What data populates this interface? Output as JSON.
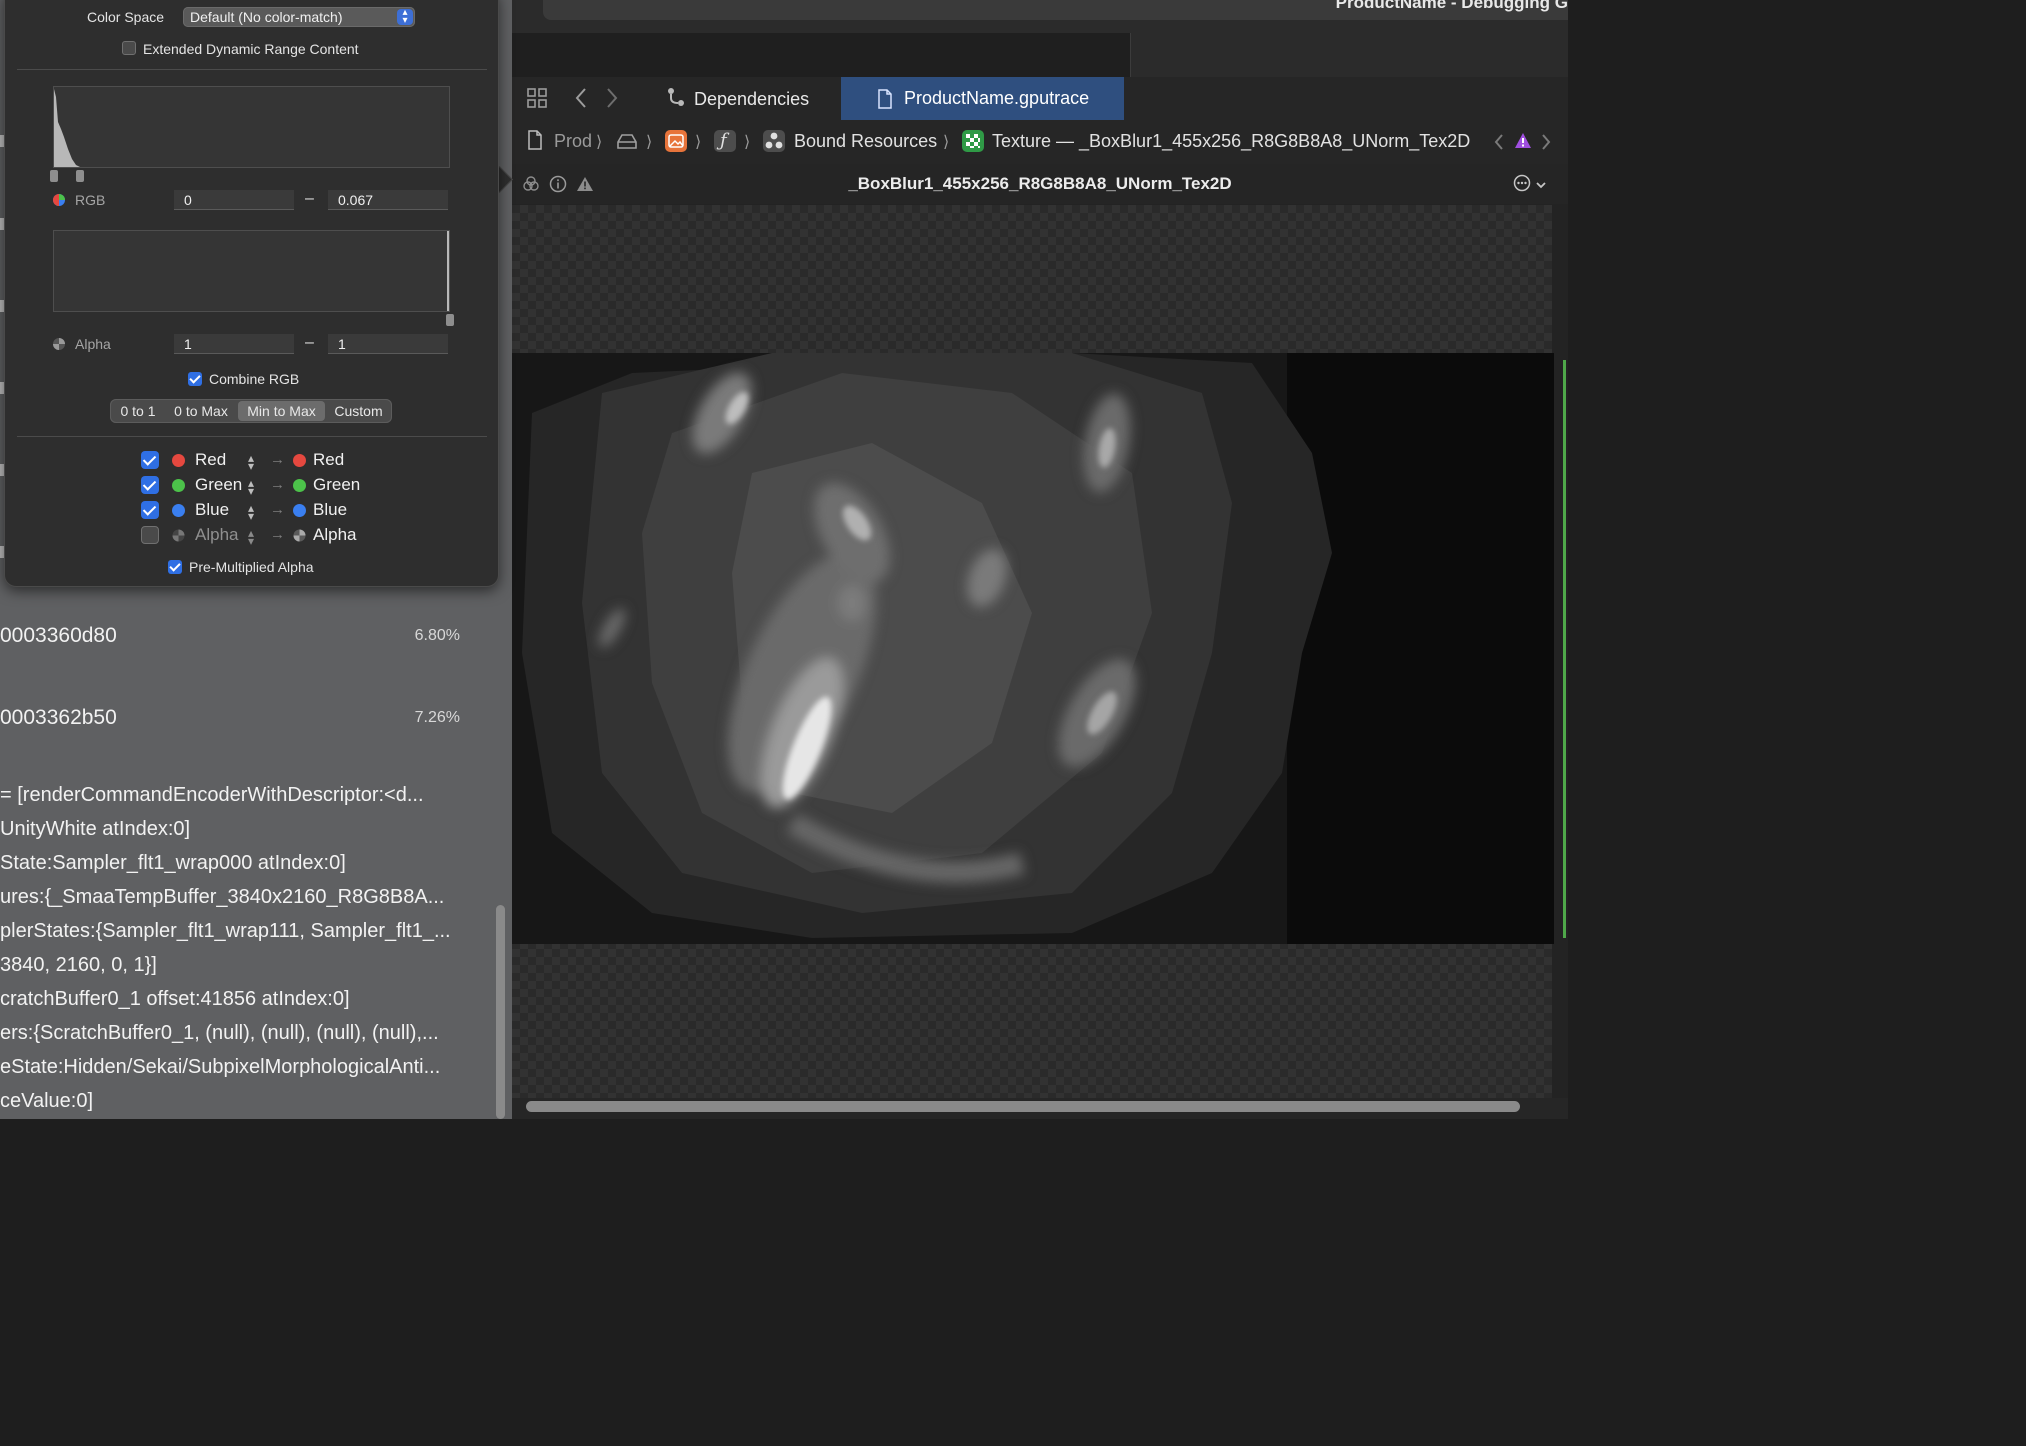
{
  "window": {
    "title": "ProductName - Debugging G"
  },
  "popover": {
    "color_space_label": "Color Space",
    "color_space_value": "Default (No color-match)",
    "edr_label": "Extended Dynamic Range Content",
    "edr_checked": false,
    "rgb": {
      "label": "RGB",
      "min": "0",
      "dash": "–",
      "max": "0.067"
    },
    "alpha": {
      "label": "Alpha",
      "min": "1",
      "dash": "–",
      "max": "1"
    },
    "combine_rgb_label": "Combine RGB",
    "combine_rgb_checked": true,
    "range_modes": [
      "0 to 1",
      "0 to Max",
      "Min to Max",
      "Custom"
    ],
    "range_selected": "Min to Max",
    "channels": [
      {
        "enabled": true,
        "source": "Red",
        "target": "Red",
        "color": "#e5483f"
      },
      {
        "enabled": true,
        "source": "Green",
        "target": "Green",
        "color": "#4cc24a"
      },
      {
        "enabled": true,
        "source": "Blue",
        "target": "Blue",
        "color": "#3a7ff0"
      },
      {
        "enabled": false,
        "source": "Alpha",
        "target": "Alpha",
        "color": "#9a9a9a"
      }
    ],
    "premultiplied_label": "Pre-Multiplied Alpha",
    "premultiplied_checked": true
  },
  "navigator": {
    "buffers": [
      {
        "address": "0003360d80",
        "percent": "6.80%"
      },
      {
        "address": "0003362b50",
        "percent": "7.26%"
      }
    ],
    "commands": [
      "= [renderCommandEncoderWithDescriptor:<d...",
      "UnityWhite atIndex:0]",
      "State:Sampler_flt1_wrap000 atIndex:0]",
      "ures:{_SmaaTempBuffer_3840x2160_R8G8B8A...",
      "plerStates:{Sampler_flt1_wrap111, Sampler_flt1_...",
      " 3840, 2160, 0, 1}]",
      "cratchBuffer0_1 offset:41856 atIndex:0]",
      "ers:{ScratchBuffer0_1, (null), (null), (null), (null),...",
      "eState:Hidden/Sekai/SubpixelMorphologicalAnti...",
      "ceValue:0]"
    ]
  },
  "editor": {
    "tabs": [
      {
        "label": "Dependencies",
        "icon": "dependencies-icon"
      },
      {
        "label": "ProductName.gputrace",
        "icon": "document-icon",
        "active": true
      }
    ],
    "breadcrumbs": [
      "Prod",
      "Bound Resources",
      "Texture — _BoxBlur1_455x256_R8G8B8A8_UNorm_Tex2D"
    ],
    "viewer_title": "_BoxBlur1_455x256_R8G8B8A8_UNorm_Tex2D",
    "colors": {
      "active_tab": "#2f4f7f",
      "accent": "#2f6fe4"
    }
  }
}
